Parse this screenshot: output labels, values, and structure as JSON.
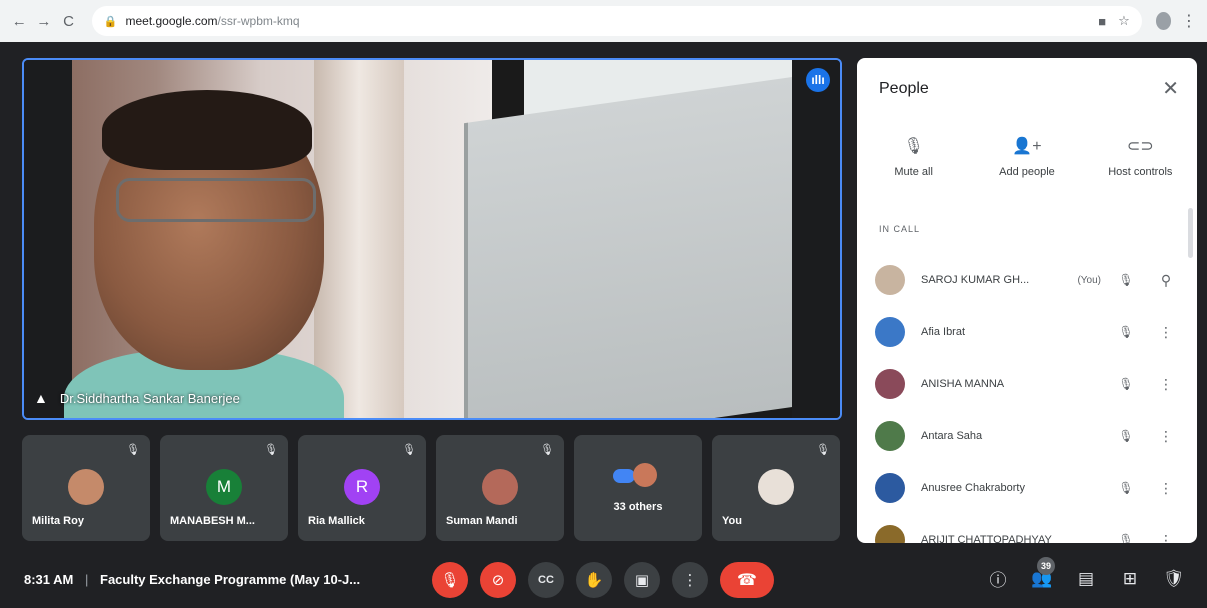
{
  "browser": {
    "url_host": "meet.google.com",
    "url_path": "/ssr-wpbm-kmq",
    "nav_back": "←",
    "nav_forward": "→",
    "nav_reload": "C",
    "lock": "🔒",
    "camera_icon": "■",
    "star": "☆",
    "menu": "⋮"
  },
  "main_video": {
    "speaker_name": "Dr.Siddhartha Sankar Banerjee",
    "speaking_glyph": "ıllı",
    "pin_glyph": "▲"
  },
  "tiles": [
    {
      "name": "Milita Roy",
      "avatar_letter": "",
      "avatar_color": "#c58a6a",
      "mic": "🎙"
    },
    {
      "name": "MANABESH M...",
      "avatar_letter": "M",
      "avatar_color": "#188038",
      "mic": "🎙"
    },
    {
      "name": "Ria Mallick",
      "avatar_letter": "R",
      "avatar_color": "#a142f4",
      "mic": "🎙"
    },
    {
      "name": "Suman Mandi",
      "avatar_letter": "",
      "avatar_color": "#b4695a",
      "mic": "🎙"
    },
    {
      "name": "33 others",
      "avatar_letter": "",
      "avatar_color": "",
      "mic": ""
    },
    {
      "name": "You",
      "avatar_letter": "",
      "avatar_color": "#e8e0d8",
      "mic": "🎙"
    }
  ],
  "bottombar": {
    "time": "8:31 AM",
    "separator": "|",
    "meeting_title": "Faculty Exchange Programme (May 10-J...",
    "controls": {
      "mic": "🎙",
      "camera": "⊘",
      "captions": "CC",
      "raise_hand": "✋",
      "present": "▣",
      "more": "⋮",
      "end_call": "☎"
    },
    "right": {
      "info": "ⓘ",
      "people": "👥",
      "people_count": "39",
      "chat": "▤",
      "activities": "⊞",
      "host": "🛡"
    }
  },
  "people_panel": {
    "title": "People",
    "close": "✕",
    "actions": [
      {
        "icon": "🎙",
        "label": "Mute all"
      },
      {
        "icon": "👤+",
        "label": "Add people"
      },
      {
        "icon": "⊂⊃",
        "label": "Host controls"
      }
    ],
    "section_label": "IN CALL",
    "participants": [
      {
        "name": "SAROJ KUMAR GH...",
        "you": "(You)",
        "avatar_color": "#c8b4a0",
        "mic": "🎙",
        "more": "⚲"
      },
      {
        "name": "Afia Ibrat",
        "you": "",
        "avatar_color": "#3b78c7",
        "mic": "🎙",
        "more": "⋮"
      },
      {
        "name": "ANISHA MANNA",
        "you": "",
        "avatar_color": "#8a4a5a",
        "mic": "🎙",
        "more": "⋮"
      },
      {
        "name": "Antara Saha",
        "you": "",
        "avatar_color": "#4f7a4a",
        "mic": "🎙",
        "more": "⋮"
      },
      {
        "name": "Anusree Chakraborty",
        "you": "",
        "avatar_color": "#2c5aa0",
        "mic": "🎙",
        "more": "⋮"
      },
      {
        "name": "ARIJIT CHATTOPADHYAY",
        "you": "",
        "avatar_color": "#8a6a2a",
        "mic": "🎙",
        "more": "⋮"
      }
    ]
  }
}
